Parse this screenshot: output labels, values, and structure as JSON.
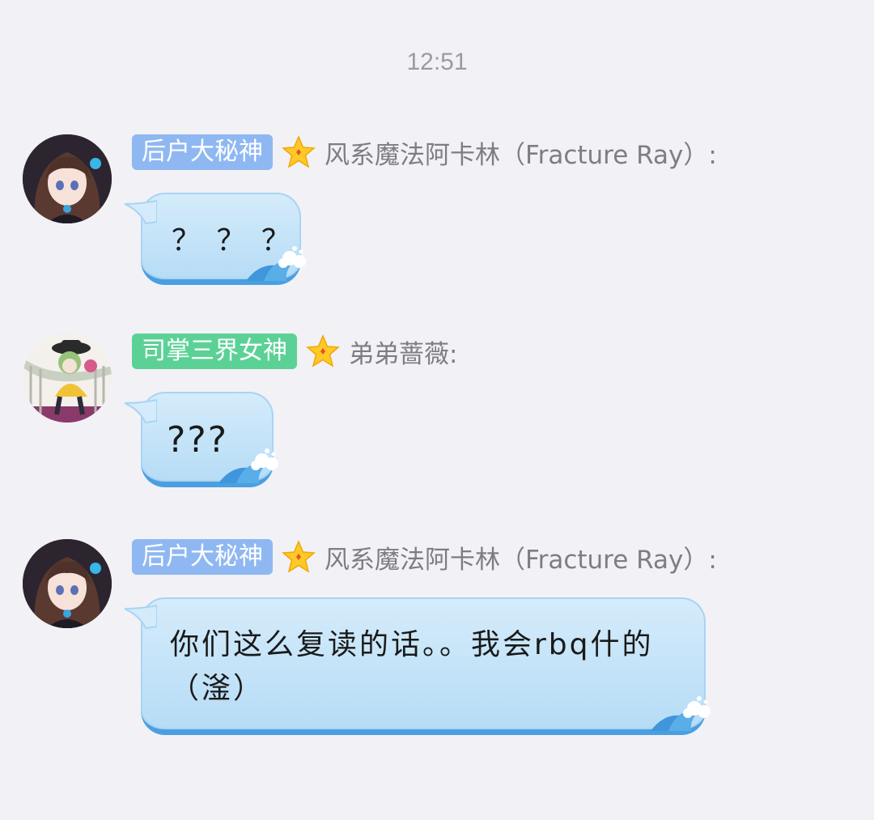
{
  "time": "12:51",
  "messages": [
    {
      "badge": "后户大秘神",
      "badge_color": "#8fb8f2",
      "sender": "风系魔法阿卡林（Fracture Ray）:",
      "text": "？ ？ ？",
      "avatar": "anime-girl-brown-hair-avatar"
    },
    {
      "badge": "司掌三界女神",
      "badge_color": "#5cd196",
      "sender": "弟弟蔷薇:",
      "text": "???",
      "avatar": "anime-character-green-hair-hat-avatar"
    },
    {
      "badge": "后户大秘神",
      "badge_color": "#8fb8f2",
      "sender": "风系魔法阿卡林（Fracture Ray）:",
      "text": "你们这么复读的话。。我会rbq什的（滏）",
      "avatar": "anime-girl-brown-hair-avatar"
    }
  ]
}
